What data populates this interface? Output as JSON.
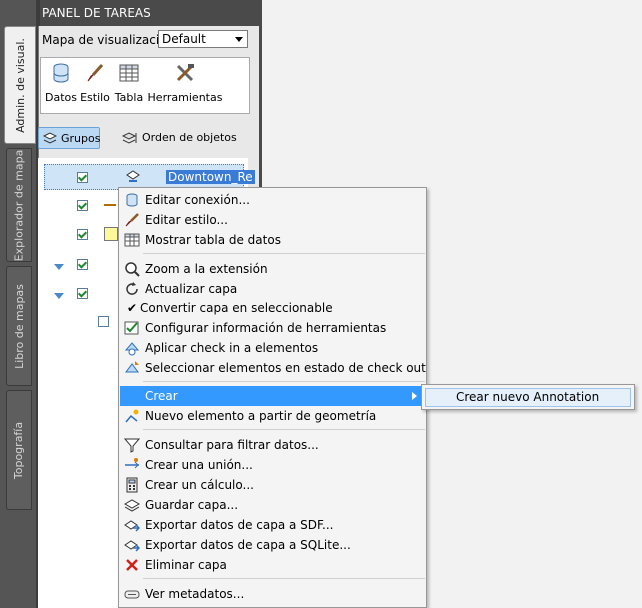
{
  "panel": {
    "title": "PANEL DE TAREAS",
    "map_label": "Mapa de visualización:",
    "map_value": "Default"
  },
  "vtabs": [
    "Admin. de visual.",
    "Explorador de mapa",
    "Libro de mapas",
    "Topografía"
  ],
  "tools": [
    {
      "label": "Datos",
      "icon": "database-icon"
    },
    {
      "label": "Estilo",
      "icon": "brush-icon"
    },
    {
      "label": "Tabla",
      "icon": "table-icon"
    },
    {
      "label": "Herramientas",
      "icon": "tools-icon"
    }
  ],
  "subbar": {
    "groups": "Grupos",
    "order": "Orden de objetos"
  },
  "tree": {
    "selected_layer": "Downtown_Re"
  },
  "menu": {
    "items": [
      {
        "label": "Editar conexión...",
        "icon": "database-icon"
      },
      {
        "label": "Editar estilo...",
        "icon": "brush-icon"
      },
      {
        "label": "Mostrar tabla de datos",
        "icon": "table-icon"
      },
      {
        "label": "Zoom a la extensión",
        "icon": "zoom-icon"
      },
      {
        "label": "Actualizar capa",
        "icon": "refresh-icon"
      },
      {
        "label": "Convertir capa en seleccionable",
        "icon": "checkmark-icon"
      },
      {
        "label": "Configurar información de herramientas",
        "icon": "tooltip-config-icon"
      },
      {
        "label": "Aplicar check in a elementos",
        "icon": "check-in-icon"
      },
      {
        "label": "Seleccionar elementos en estado de check out",
        "icon": "check-out-select-icon"
      },
      {
        "label": "Crear",
        "icon": ""
      },
      {
        "label": "Nuevo elemento a partir de geometría",
        "icon": "new-feature-icon"
      },
      {
        "label": "Consultar para filtrar datos...",
        "icon": "filter-icon"
      },
      {
        "label": "Crear una unión...",
        "icon": "join-icon"
      },
      {
        "label": "Crear un cálculo...",
        "icon": "calculator-icon"
      },
      {
        "label": "Guardar capa...",
        "icon": "save-layer-icon"
      },
      {
        "label": "Exportar datos de capa a SDF...",
        "icon": "export-sdf-icon"
      },
      {
        "label": "Exportar datos de capa a SQLite...",
        "icon": "export-sqlite-icon"
      },
      {
        "label": "Eliminar capa",
        "icon": "delete-icon"
      },
      {
        "label": "Ver metadatos...",
        "icon": "metadata-icon"
      }
    ],
    "submenu": {
      "label": "Crear nuevo Annotation"
    }
  }
}
